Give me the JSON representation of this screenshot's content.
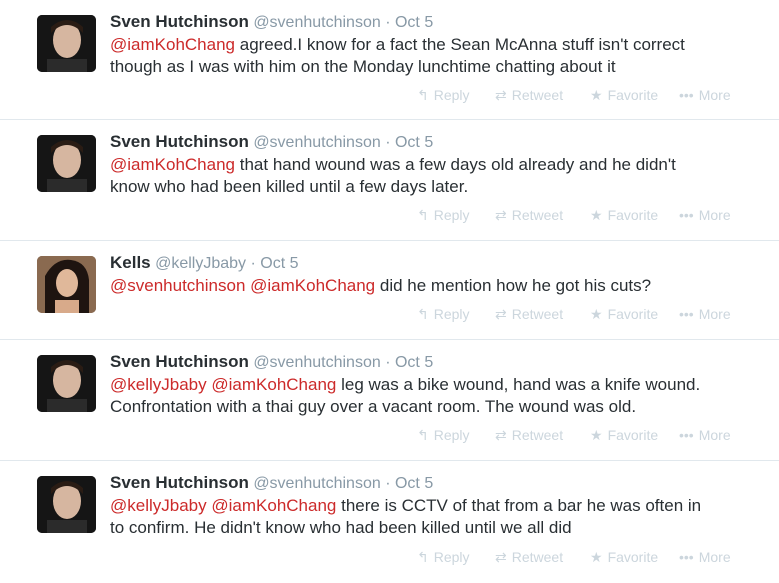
{
  "tweets": [
    {
      "name": "Sven Hutchinson",
      "handle": "@svenhutchinson",
      "time": "Oct 5",
      "avatar": "sven",
      "mentions": [
        "@iamKohChang"
      ],
      "line1": "agreed.I know for a fact the Sean McAnna stuff isn't correct",
      "line2": "though as I was with him on the Monday lunchtime chatting about it"
    },
    {
      "name": "Sven Hutchinson",
      "handle": "@svenhutchinson",
      "time": "Oct 5",
      "avatar": "sven",
      "mentions": [
        "@iamKohChang"
      ],
      "line1": "that hand wound was a few days old already and he didn't",
      "line2": "know who had been killed until a few days later."
    },
    {
      "name": "Kells",
      "handle": "@kellyJbaby",
      "time": "Oct 5",
      "avatar": "kells",
      "mentions": [
        "@svenhutchinson",
        "@iamKohChang"
      ],
      "line1": "did he mention how he got his cuts?",
      "line2": ""
    },
    {
      "name": "Sven Hutchinson",
      "handle": "@svenhutchinson",
      "time": "Oct 5",
      "avatar": "sven",
      "mentions": [
        "@kellyJbaby",
        "@iamKohChang"
      ],
      "line1": "leg was a bike wound, hand was a knife wound.",
      "line2": "Confrontation with a thai guy over a vacant room.  The wound was old."
    },
    {
      "name": "Sven Hutchinson",
      "handle": "@svenhutchinson",
      "time": "Oct 5",
      "avatar": "sven",
      "mentions": [
        "@kellyJbaby",
        "@iamKohChang"
      ],
      "line1": "there is CCTV of that from a bar he was often in",
      "line2": "to confirm.  He didn't know who had been killed until we all did"
    }
  ],
  "actions": {
    "reply": "Reply",
    "retweet": "Retweet",
    "favorite": "Favorite",
    "more": "More",
    "icons": [
      "reply-arrow-icon",
      "retweet-icon",
      "star-icon",
      "ellipsis-icon"
    ]
  },
  "separator": "·",
  "colors": {
    "mention": "#cc2a2a",
    "meta": "#8899a6",
    "action": "#ccd6dd",
    "divider": "#e1e8ed"
  }
}
